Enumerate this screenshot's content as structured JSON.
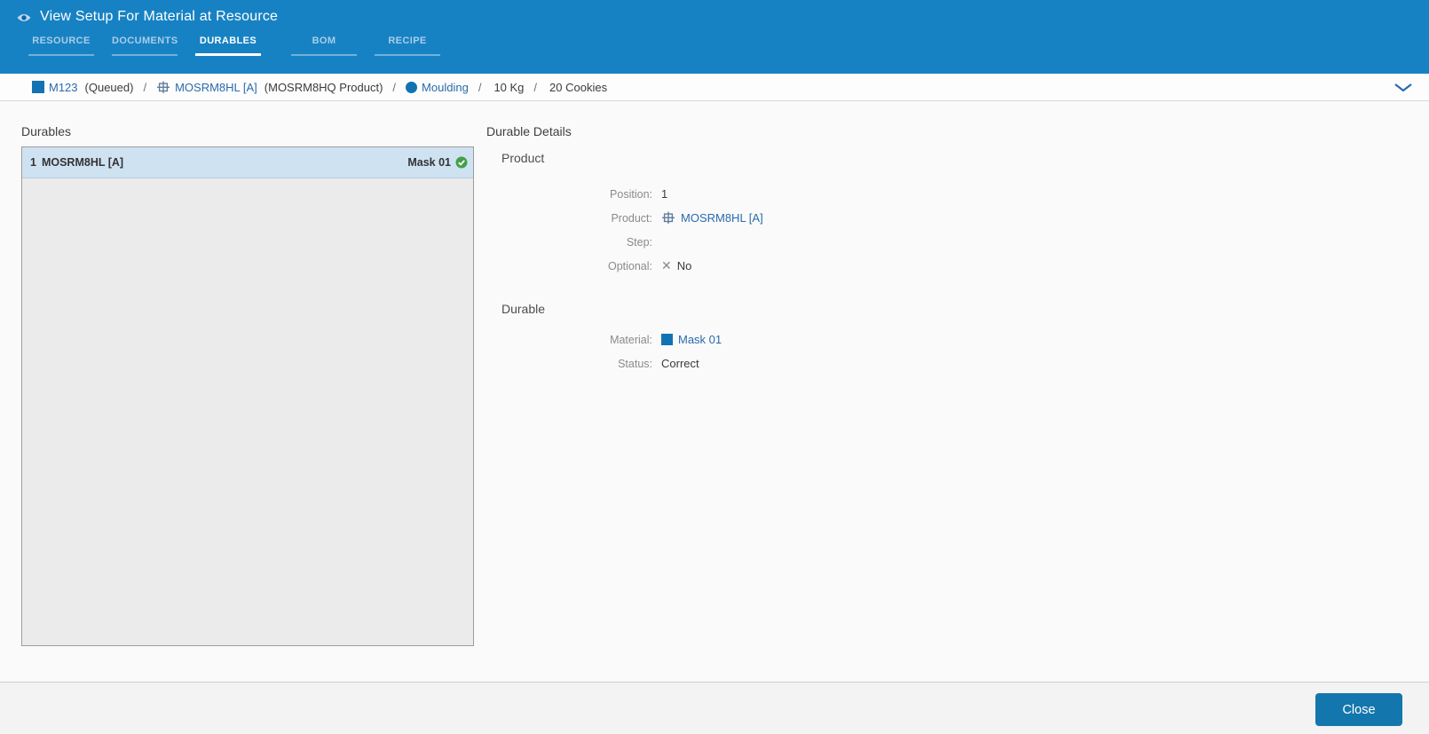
{
  "header": {
    "title": "View Setup For Material at Resource",
    "tabs": [
      {
        "label": "RESOURCE",
        "active": false
      },
      {
        "label": "DOCUMENTS",
        "active": false
      },
      {
        "label": "DURABLES",
        "active": true
      },
      {
        "label": "BOM",
        "active": false
      },
      {
        "label": "RECIPE",
        "active": false
      }
    ]
  },
  "breadcrumb": {
    "material": "M123",
    "material_state": "(Queued)",
    "product": "MOSRM8HL [A]",
    "product_note": "(MOSRM8HQ Product)",
    "step": "Moulding",
    "primary_quantity": "10 Kg",
    "secondary_quantity": "20 Cookies",
    "separator": "/"
  },
  "durables_panel": {
    "title": "Durables",
    "items": [
      {
        "position": "1",
        "product": "MOSRM8HL [A]",
        "durable": "Mask 01",
        "selected": true
      }
    ]
  },
  "details_panel": {
    "title": "Durable Details",
    "product_section": {
      "title": "Product",
      "fields": [
        {
          "label": "Position:",
          "value": "1"
        },
        {
          "label": "Product:",
          "value": "MOSRM8HL [A]"
        },
        {
          "label": "Step:",
          "value": ""
        },
        {
          "label": "Optional:",
          "value": "No"
        }
      ]
    },
    "durable_section": {
      "title": "Durable",
      "fields": [
        {
          "label": "Material:",
          "value": "Mask 01"
        },
        {
          "label": "Status:",
          "value": "Correct"
        }
      ]
    }
  },
  "footer": {
    "close_label": "Close"
  },
  "icons": {
    "cross": "✕"
  },
  "colors": {
    "header_bg": "#1782c3",
    "link_blue": "#2a6bad",
    "icon_blue": "#1273b2",
    "selected_row_bg": "#cfe2f2",
    "success_green": "#43a047",
    "button_bg": "#1377ad"
  }
}
